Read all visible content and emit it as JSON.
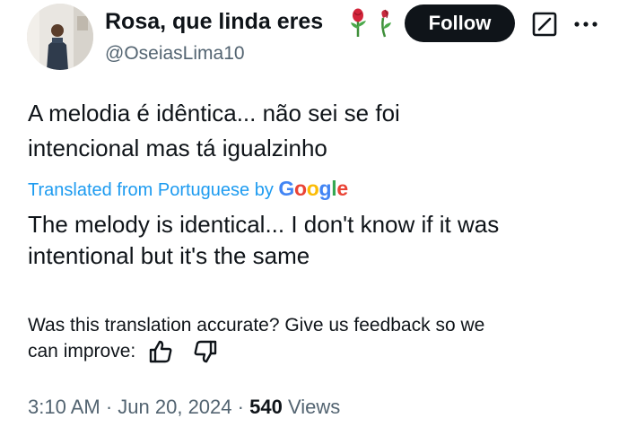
{
  "author": {
    "display_name": "Rosa, que linda eres",
    "handle": "@OseiasLima10",
    "name_emoji": [
      "rose-icon",
      "wilted-rose-icon"
    ]
  },
  "header": {
    "follow_label": "Follow",
    "grok_icon": "grok-icon",
    "more_icon": "more-icon"
  },
  "post": {
    "original_line_1": "A melodia é idêntica... não sei se foi",
    "original_line_2": "intencional mas tá igualzinho",
    "translated_from": "Translated from Portuguese by",
    "translator": "Google",
    "translation_line_1": "The melody is identical... I don't know if it was",
    "translation_line_2": "intentional but it's the same"
  },
  "feedback": {
    "line_1": "Was this translation accurate? Give us feedback so we",
    "line_2": "can improve:",
    "thumbs_up_icon": "thumbs-up-icon",
    "thumbs_down_icon": "thumbs-down-icon"
  },
  "meta": {
    "time": "3:10 AM",
    "separator": "·",
    "date": "Jun 20, 2024",
    "views_count": "540",
    "views_label": "Views"
  },
  "colors": {
    "text": "#0f1419",
    "secondary": "#536471",
    "link": "#1d9bf0",
    "follow_bg": "#0f1419",
    "google_blue": "#4285F4",
    "google_red": "#EA4335",
    "google_yellow": "#FBBC05",
    "google_green": "#34A853"
  }
}
